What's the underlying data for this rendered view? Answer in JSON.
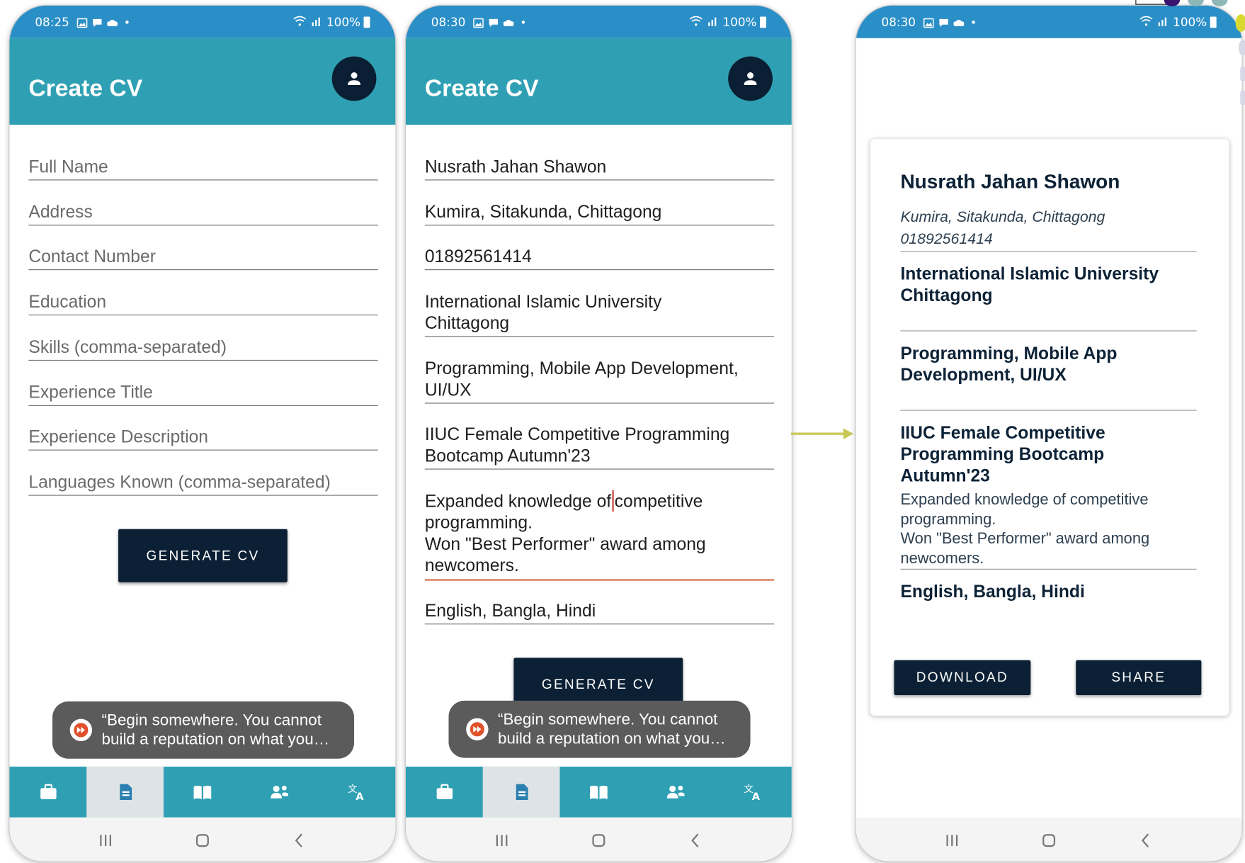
{
  "status_bar": {
    "time_1": "08:25",
    "time_2": "08:30",
    "time_3": "08:30",
    "battery": "100%"
  },
  "app": {
    "title": "Create CV"
  },
  "form_placeholders": {
    "full_name": "Full Name",
    "address": "Address",
    "contact": "Contact Number",
    "education": "Education",
    "skills": "Skills (comma-separated)",
    "experience_title": "Experience Title",
    "experience_description": "Experience Description",
    "languages": "Languages Known (comma-separated)"
  },
  "form_values": {
    "full_name": "Nusrath Jahan Shawon",
    "address": "Kumira, Sitakunda, Chittagong",
    "contact": "01892561414",
    "education_line1": "International Islamic University",
    "education_line2": "Chittagong",
    "skills_line1": "Programming, Mobile App Development,",
    "skills_line2": "UI/UX",
    "experience_title_line1": "IIUC Female Competitive Programming",
    "experience_title_line2": "Bootcamp Autumn'23",
    "experience_description_before_caret": "Expanded knowledge of",
    "experience_description_after_caret": "competitive",
    "experience_description_rest": "programming.\nWon \"Best Performer\" award among\nnewcomers.",
    "languages": "English, Bangla, Hindi"
  },
  "buttons": {
    "generate_cv": "GENERATE CV",
    "download": "DOWNLOAD",
    "share": "SHARE"
  },
  "toast": {
    "message": "“Begin somewhere. You cannot\nbuild a reputation on what you…"
  },
  "cv": {
    "name": "Nusrath Jahan Shawon",
    "address": "Kumira, Sitakunda, Chittagong",
    "contact": "01892561414",
    "education": "International Islamic University Chittagong",
    "skills": "Programming, Mobile App Development, UI/UX",
    "experience_title": "IIUC Female Competitive Programming Bootcamp Autumn'23",
    "experience_description": "Expanded knowledge of competitive\nprogramming.\nWon \"Best Performer\" award among\nnewcomers.",
    "languages": "English, Bangla, Hindi"
  },
  "nav": {
    "items": [
      {
        "icon": "briefcase-icon"
      },
      {
        "icon": "document-icon",
        "selected": true
      },
      {
        "icon": "book-icon"
      },
      {
        "icon": "people-icon"
      },
      {
        "icon": "translate-icon"
      }
    ]
  },
  "colors": {
    "status_bar": "#2b8fc7",
    "app_bar": "#2fa0b3",
    "button_dark": "#0b2034",
    "toast": "#5b5b5b",
    "active_underline": "#d8714f",
    "arrow": "#c9c95a"
  }
}
